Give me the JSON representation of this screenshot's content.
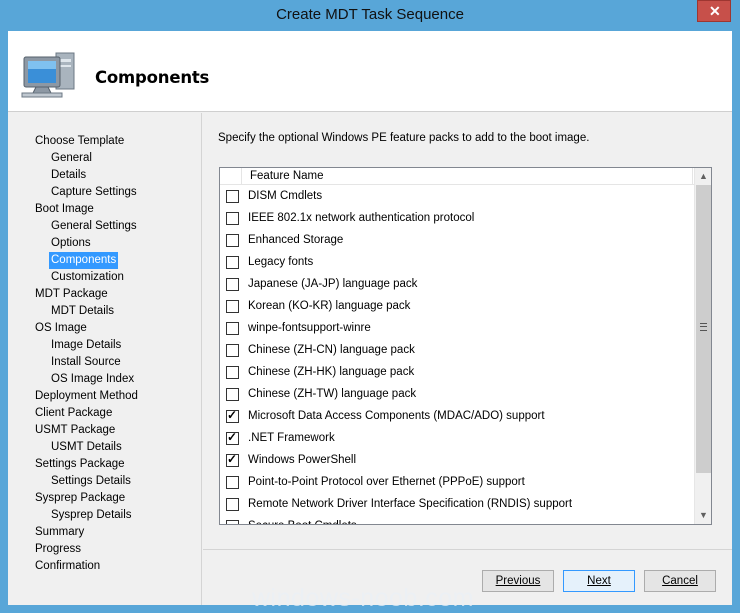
{
  "window": {
    "title": "Create MDT Task Sequence"
  },
  "header": {
    "title": "Components",
    "icon": "computer-icon"
  },
  "nav": {
    "items": [
      {
        "label": "Choose Template",
        "level": 0,
        "active": false
      },
      {
        "label": "General",
        "level": 1,
        "active": false
      },
      {
        "label": "Details",
        "level": 1,
        "active": false
      },
      {
        "label": "Capture Settings",
        "level": 1,
        "active": false
      },
      {
        "label": "Boot Image",
        "level": 0,
        "active": false
      },
      {
        "label": "General Settings",
        "level": 1,
        "active": false
      },
      {
        "label": "Options",
        "level": 1,
        "active": false
      },
      {
        "label": "Components",
        "level": 1,
        "active": true
      },
      {
        "label": "Customization",
        "level": 1,
        "active": false
      },
      {
        "label": "MDT Package",
        "level": 0,
        "active": false
      },
      {
        "label": "MDT Details",
        "level": 1,
        "active": false
      },
      {
        "label": "OS Image",
        "level": 0,
        "active": false
      },
      {
        "label": "Image Details",
        "level": 1,
        "active": false
      },
      {
        "label": "Install Source",
        "level": 1,
        "active": false
      },
      {
        "label": "OS Image Index",
        "level": 1,
        "active": false
      },
      {
        "label": "Deployment Method",
        "level": 0,
        "active": false
      },
      {
        "label": "Client Package",
        "level": 0,
        "active": false
      },
      {
        "label": "USMT Package",
        "level": 0,
        "active": false
      },
      {
        "label": "USMT Details",
        "level": 1,
        "active": false
      },
      {
        "label": "Settings Package",
        "level": 0,
        "active": false
      },
      {
        "label": "Settings Details",
        "level": 1,
        "active": false
      },
      {
        "label": "Sysprep Package",
        "level": 0,
        "active": false
      },
      {
        "label": "Sysprep Details",
        "level": 1,
        "active": false
      },
      {
        "label": "Summary",
        "level": 0,
        "active": false
      },
      {
        "label": "Progress",
        "level": 0,
        "active": false
      },
      {
        "label": "Confirmation",
        "level": 0,
        "active": false
      }
    ]
  },
  "main": {
    "description": "Specify the optional Windows PE feature packs to add to the boot image.",
    "list": {
      "column_header": "Feature Name",
      "rows": [
        {
          "label": "DISM Cmdlets",
          "checked": false
        },
        {
          "label": "IEEE 802.1x network authentication protocol",
          "checked": false
        },
        {
          "label": "Enhanced Storage",
          "checked": false
        },
        {
          "label": "Legacy fonts",
          "checked": false
        },
        {
          "label": "Japanese (JA-JP) language pack",
          "checked": false
        },
        {
          "label": "Korean (KO-KR) language pack",
          "checked": false
        },
        {
          "label": "winpe-fontsupport-winre",
          "checked": false
        },
        {
          "label": "Chinese (ZH-CN) language pack",
          "checked": false
        },
        {
          "label": "Chinese (ZH-HK) language pack",
          "checked": false
        },
        {
          "label": "Chinese (ZH-TW) language pack",
          "checked": false
        },
        {
          "label": "Microsoft Data Access Components (MDAC/ADO) support",
          "checked": true
        },
        {
          "label": ".NET Framework",
          "checked": true
        },
        {
          "label": "Windows PowerShell",
          "checked": true
        },
        {
          "label": "Point-to-Point Protocol over Ethernet (PPPoE) support",
          "checked": false
        },
        {
          "label": "Remote Network Driver Interface Specification (RNDIS) support",
          "checked": false
        },
        {
          "label": "Secure Boot Cmdlets",
          "checked": false
        }
      ]
    }
  },
  "footer": {
    "previous_label": "Previous",
    "next_label": "Next",
    "cancel_label": "Cancel"
  },
  "watermark": "windows-noob.com",
  "colors": {
    "titlebar": "#58a6d8",
    "selection": "#3399ff",
    "close": "#c7504a"
  }
}
